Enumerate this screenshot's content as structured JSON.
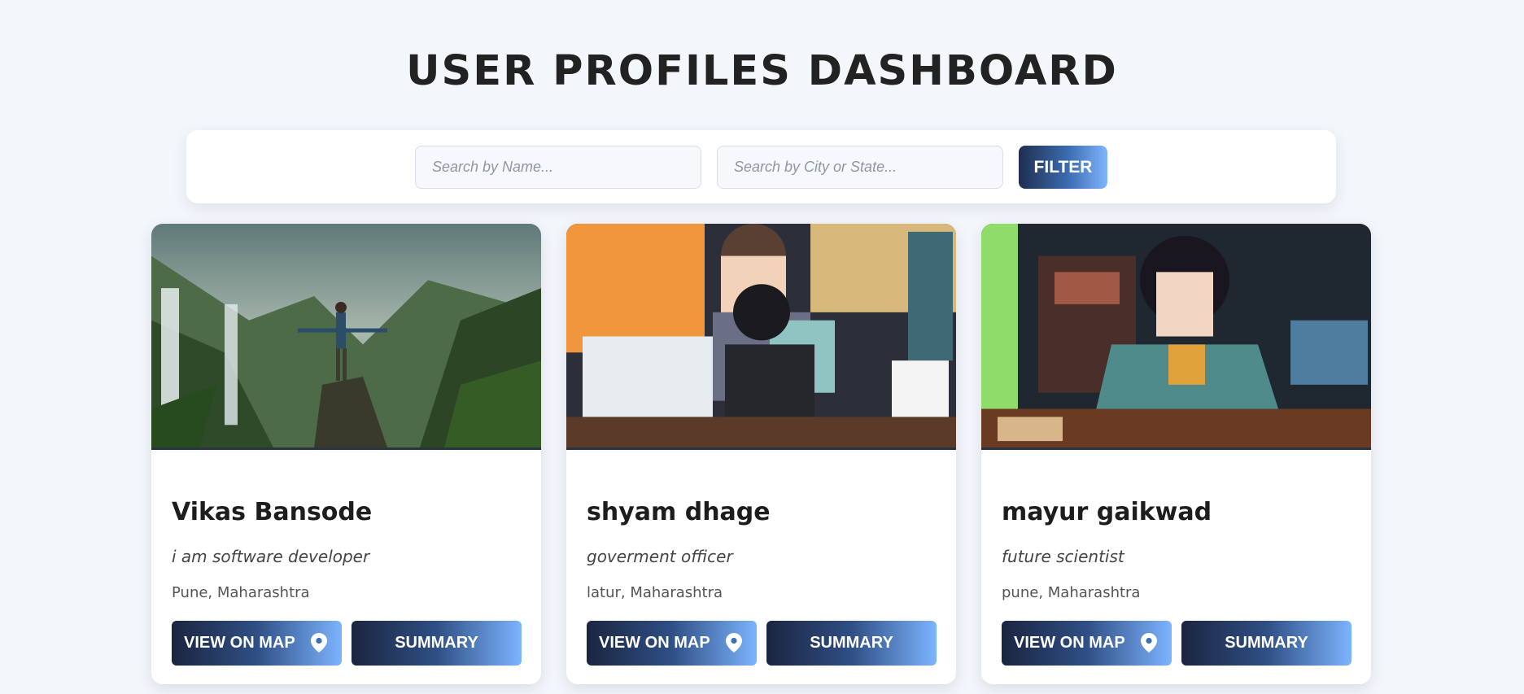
{
  "page": {
    "title": "USER PROFILES DASHBOARD"
  },
  "filters": {
    "name_placeholder": "Search by Name...",
    "name_value": "",
    "city_placeholder": "Search by City or State...",
    "city_value": "",
    "filter_label": "FILTER"
  },
  "cards": [
    {
      "name": "Vikas Bansode",
      "bio": "i am software developer",
      "location": "Pune, Maharashtra",
      "map_label": "VIEW ON MAP",
      "summary_label": "SUMMARY",
      "image": "waterfall-adventure-photo"
    },
    {
      "name": "shyam dhage",
      "bio": "goverment officer",
      "location": "latur, Maharashtra",
      "map_label": "VIEW ON MAP",
      "summary_label": "SUMMARY",
      "image": "anime-office-illustration"
    },
    {
      "name": "mayur gaikwad",
      "bio": "future scientist",
      "location": "pune, Maharashtra",
      "map_label": "VIEW ON MAP",
      "summary_label": "SUMMARY",
      "image": "anime-artist-illustration"
    }
  ],
  "icons": {
    "map_button": "map-pin-icon"
  },
  "colors": {
    "background": "#f3f6fb",
    "button_dark": "#1b2540",
    "button_light": "#7cb4ff"
  }
}
